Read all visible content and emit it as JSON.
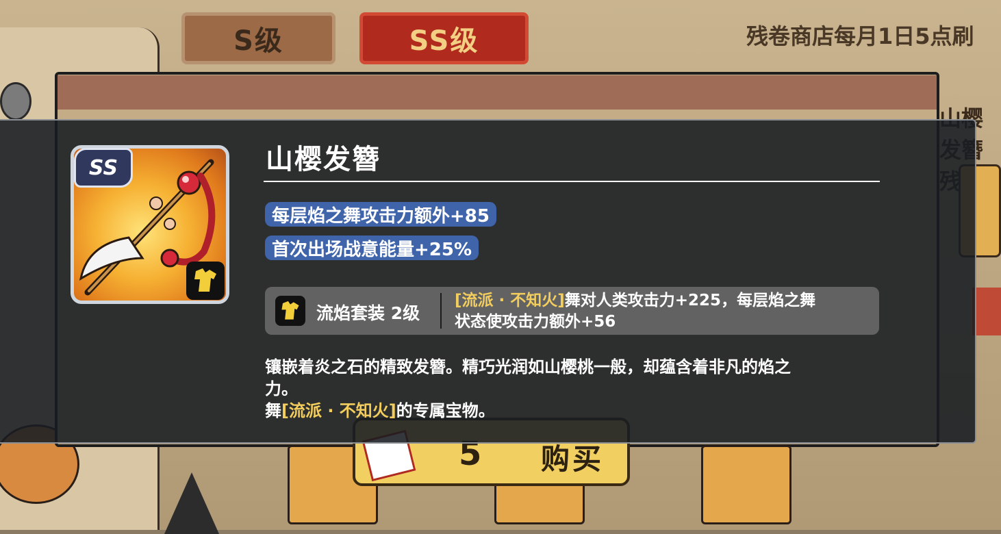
{
  "background": {
    "tabs": {
      "s_grade": "S级",
      "ss_grade": "SS级"
    },
    "shop_notice": "残卷商店每月1日5点刷",
    "right_title": "山樱发簪残卷",
    "buy_button": {
      "price": "5",
      "label": "购买"
    }
  },
  "item": {
    "grade": "SS",
    "name": "山樱发簪",
    "stats": [
      {
        "text": "每层焰之舞攻击力额外+85"
      },
      {
        "text": "首次出场战意能量+25%"
      }
    ],
    "set": {
      "name": "流焰套装 2级",
      "school_tag": "[流派 · 不知火]",
      "effect_line1": "舞对人类攻击力+225，每层焰之舞",
      "effect_line2": "状态使攻击力额外+56"
    },
    "description": {
      "line1": "镶嵌着炎之石的精致发簪。精巧光润如山樱桃一般，却蕴含着非凡的焰之",
      "line2": "力。",
      "owner_prefix": "舞",
      "owner_tag": "[流派 · 不知火]",
      "owner_suffix": "的专属宝物。"
    }
  },
  "colors": {
    "stat_pill": "#3f64aa",
    "gold_tag": "#f3cd5d",
    "ss_tab": "#b02a1e",
    "buy_button": "#f2cf61"
  },
  "icons": [
    "hairpin-item-icon",
    "ss-grade-badge",
    "shirt-set-icon"
  ]
}
